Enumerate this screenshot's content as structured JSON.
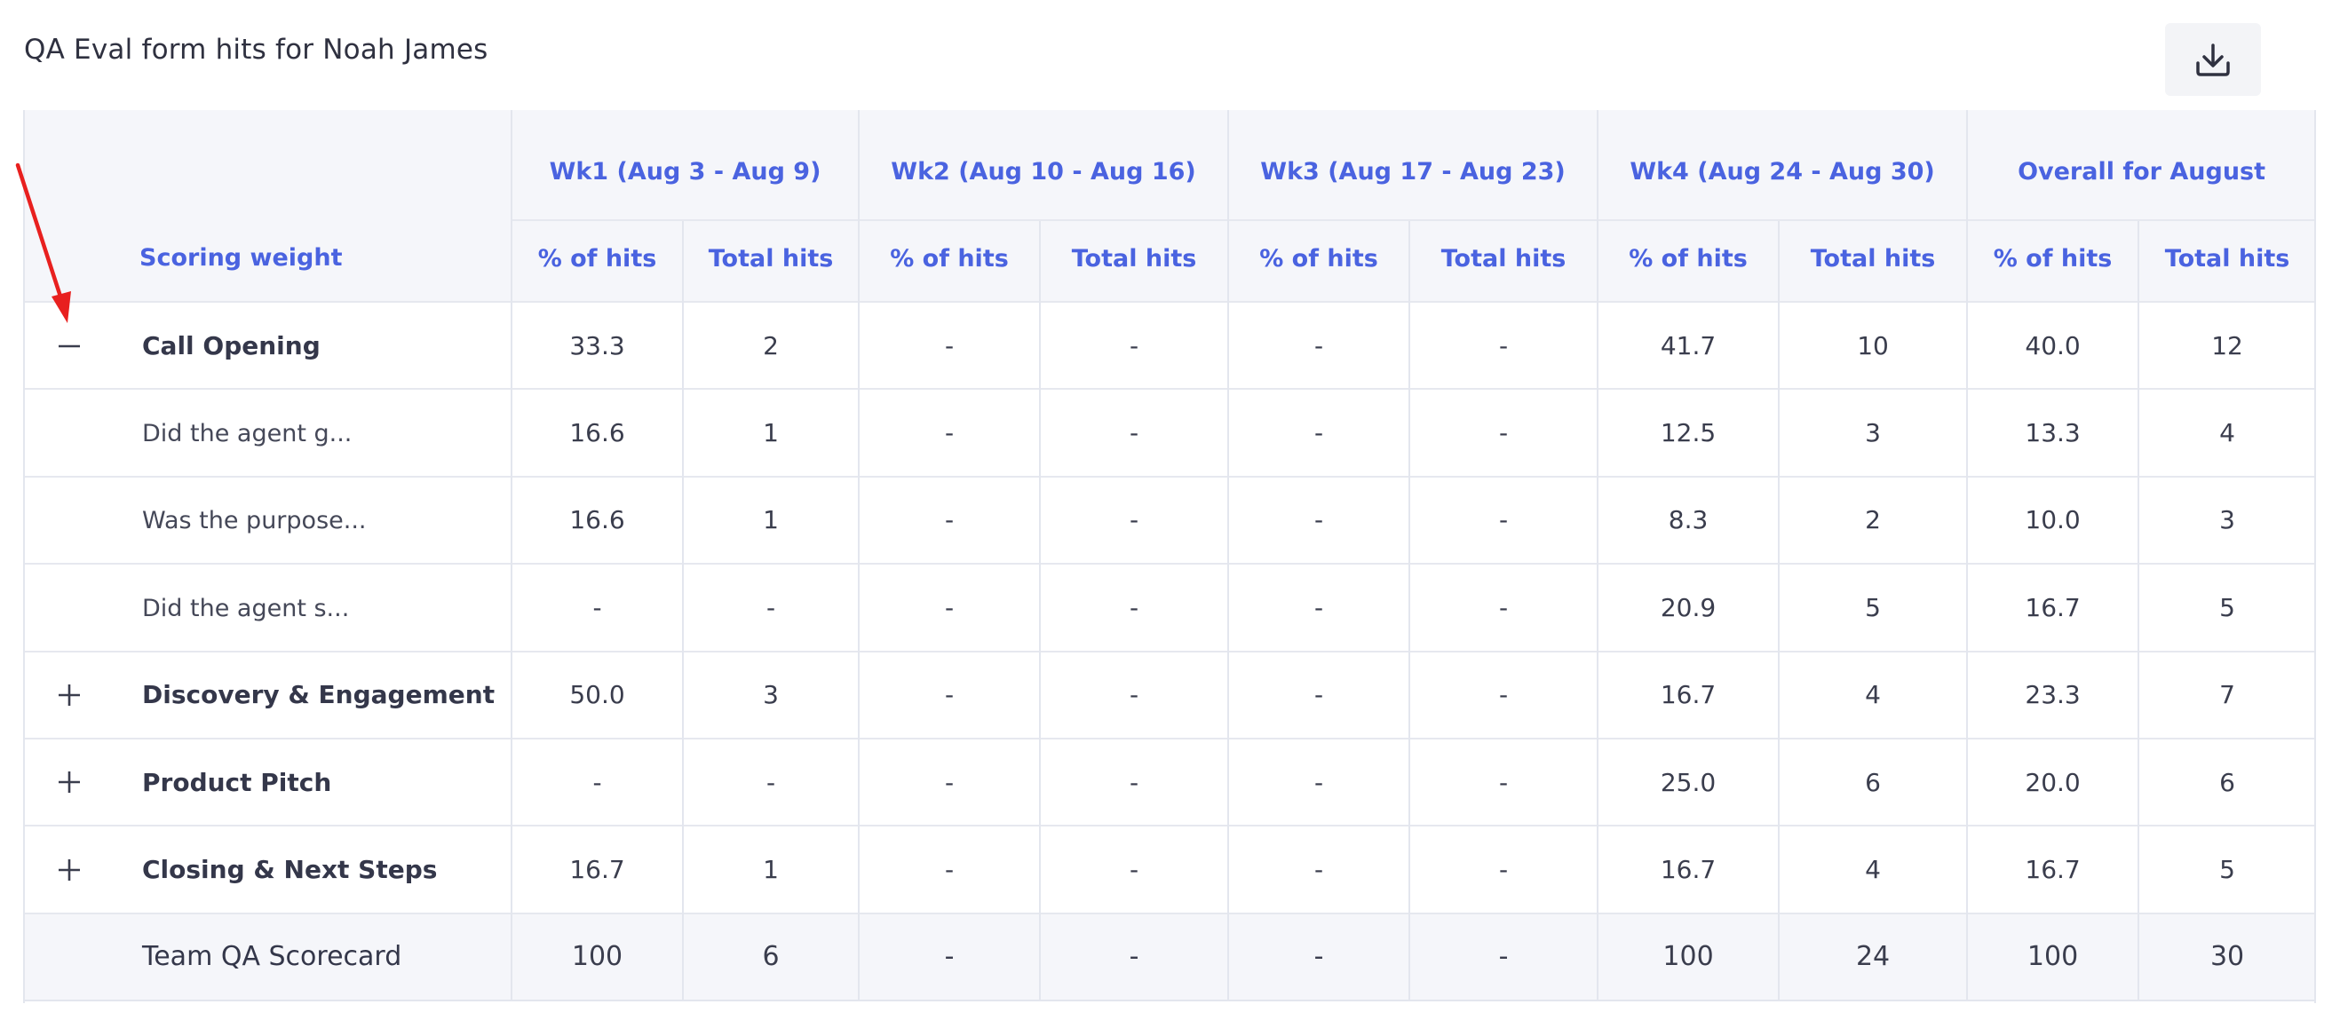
{
  "title": "QA Eval form hits for Noah James",
  "header": {
    "scoring_weight": "Scoring weight",
    "weeks": [
      {
        "label": "Wk1 (Aug 3 - Aug 9)"
      },
      {
        "label": "Wk2 (Aug 10 - Aug 16)"
      },
      {
        "label": "Wk3 (Aug 17 - Aug 23)"
      },
      {
        "label": "Wk4 (Aug 24 - Aug 30)"
      },
      {
        "label": "Overall for August"
      }
    ],
    "pct_label": "% of hits",
    "total_label": "Total hits"
  },
  "rows": [
    {
      "label": "Call Opening",
      "toggle": "collapse",
      "cells": [
        "33.3",
        "2",
        "-",
        "-",
        "-",
        "-",
        "41.7",
        "10",
        "40.0",
        "12"
      ]
    },
    {
      "label": "Did the agent g...",
      "cells": [
        "16.6",
        "1",
        "-",
        "-",
        "-",
        "-",
        "12.5",
        "3",
        "13.3",
        "4"
      ]
    },
    {
      "label": "Was the purpose...",
      "cells": [
        "16.6",
        "1",
        "-",
        "-",
        "-",
        "-",
        "8.3",
        "2",
        "10.0",
        "3"
      ]
    },
    {
      "label": "Did the agent s...",
      "cells": [
        "-",
        "-",
        "-",
        "-",
        "-",
        "-",
        "20.9",
        "5",
        "16.7",
        "5"
      ]
    },
    {
      "label": "Discovery & Engagement",
      "toggle": "expand",
      "cells": [
        "50.0",
        "3",
        "-",
        "-",
        "-",
        "-",
        "16.7",
        "4",
        "23.3",
        "7"
      ]
    },
    {
      "label": "Product Pitch",
      "toggle": "expand",
      "cells": [
        "-",
        "-",
        "-",
        "-",
        "-",
        "-",
        "25.0",
        "6",
        "20.0",
        "6"
      ]
    },
    {
      "label": "Closing & Next Steps",
      "toggle": "expand",
      "cells": [
        "16.7",
        "1",
        "-",
        "-",
        "-",
        "-",
        "16.7",
        "4",
        "16.7",
        "5"
      ]
    }
  ],
  "total_row": {
    "label": "Team QA Scorecard",
    "cells": [
      "100",
      "6",
      "-",
      "-",
      "-",
      "-",
      "100",
      "24",
      "100",
      "30"
    ]
  },
  "colors": {
    "accent": "#4a63e0",
    "header_bg": "#f5f6fa",
    "annotation_arrow": "#e8201f"
  },
  "icons": {
    "download": "download-icon",
    "collapse": "minus-icon",
    "expand": "plus-icon"
  }
}
